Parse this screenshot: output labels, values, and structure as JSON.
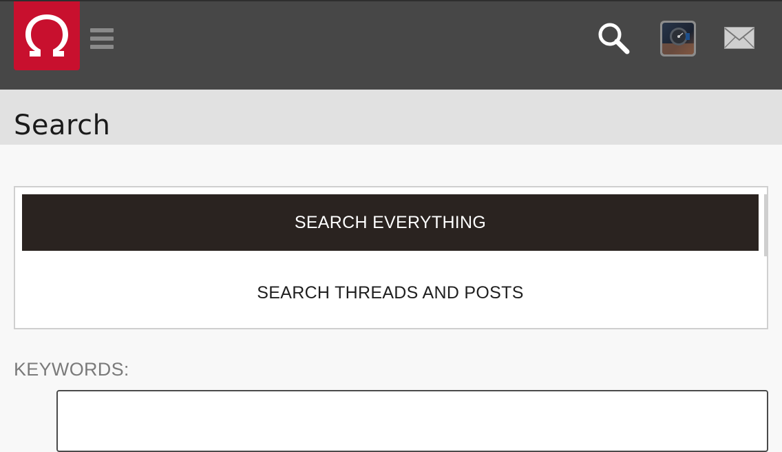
{
  "header": {
    "logo_icon": "omega-logo-icon",
    "menu_icon": "hamburger-menu-icon",
    "search_icon": "magnifier-search-icon",
    "avatar_icon": "user-avatar-watch-photo",
    "mail_icon": "envelope-mail-icon",
    "brand_color": "#c8102e",
    "bar_color": "#474747"
  },
  "page": {
    "title": "Search"
  },
  "tabs": [
    {
      "label": "SEARCH EVERYTHING",
      "active": true
    },
    {
      "label": "SEARCH THREADS AND POSTS",
      "active": false
    }
  ],
  "form": {
    "keywords_label": "KEYWORDS:",
    "keywords_value": ""
  }
}
